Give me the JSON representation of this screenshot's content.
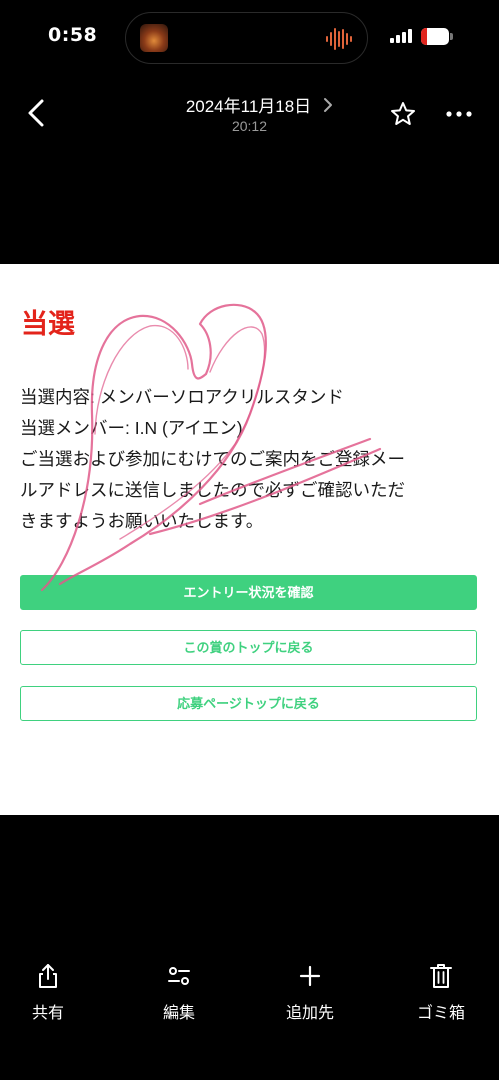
{
  "status_bar": {
    "time": "0:58",
    "battery_level": "20",
    "battery_fraction": 0.2,
    "battery_color": "#e0241d",
    "island_icons": [
      "album-art-icon",
      "waveform-icon"
    ]
  },
  "nav": {
    "date_title": "2024年11月18日",
    "time_subtitle": "20:12",
    "icons": [
      "chevron-left-icon",
      "chevron-right-icon",
      "star-icon",
      "more-icon"
    ]
  },
  "photo": {
    "heading": "当選",
    "heading_color": "#e3241b",
    "accent_color": "#3fd17f",
    "doodle_color": "#e05a8a",
    "body_lines": [
      "当選内容: メンバーソロアクリルスタンド",
      "当選メンバー: I.N (アイエン)",
      "ご当選および参加にむけてのご案内をご登録メー",
      "ルアドレスに送信しましたので必ずご確認いただ",
      "きますようお願いいたします。"
    ],
    "buttons": {
      "check_entry": "エントリー状況を確認",
      "back_to_award": "この賞のトップに戻る",
      "back_to_top": "応募ページトップに戻る"
    }
  },
  "toolbar": {
    "share": "共有",
    "edit": "編集",
    "add_to": "追加先",
    "trash": "ゴミ箱",
    "icons": [
      "share-icon",
      "edit-sliders-icon",
      "plus-icon",
      "trash-icon"
    ]
  }
}
